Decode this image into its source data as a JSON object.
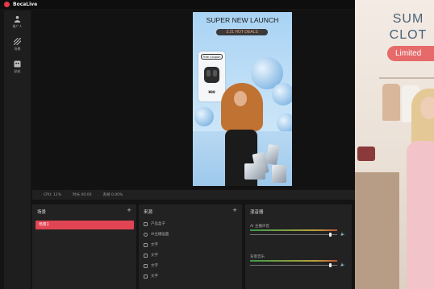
{
  "app": {
    "title": "BocaLive",
    "accent": "#e8394a"
  },
  "sidebar": {
    "items": [
      {
        "label": "推广人",
        "icon": "user-icon"
      },
      {
        "label": "场景",
        "icon": "scene-icon"
      },
      {
        "label": "贴纸",
        "icon": "sticker-icon"
      }
    ]
  },
  "canvas": {
    "headline": "SUPER NEW LAUNCH",
    "deals": "3.21 HOT DEALS",
    "product_label": "Free Coupon",
    "price": "¥99"
  },
  "preview": {
    "title_line1": "SUM",
    "title_line2": "CLOT",
    "pill": "Limited"
  },
  "stats": {
    "cpu": "CPU: 11%",
    "time": "时长 00:00",
    "drop": "丢帧 0.00%"
  },
  "scenes_panel": {
    "title": "场景",
    "add": "+",
    "items": [
      {
        "label": "场景1"
      }
    ]
  },
  "sources_panel": {
    "title": "来源",
    "add": "+",
    "items": [
      {
        "label": "产品盒子"
      },
      {
        "label": "AI主播画面"
      },
      {
        "label": "文字"
      },
      {
        "label": "文字"
      },
      {
        "label": "文字"
      },
      {
        "label": "文字"
      }
    ]
  },
  "mixer_panel": {
    "title": "混音器",
    "channels": [
      {
        "label": "AI 主播声音",
        "volume": 0.92
      },
      {
        "label": "背景音乐",
        "volume": 0.92
      }
    ]
  }
}
